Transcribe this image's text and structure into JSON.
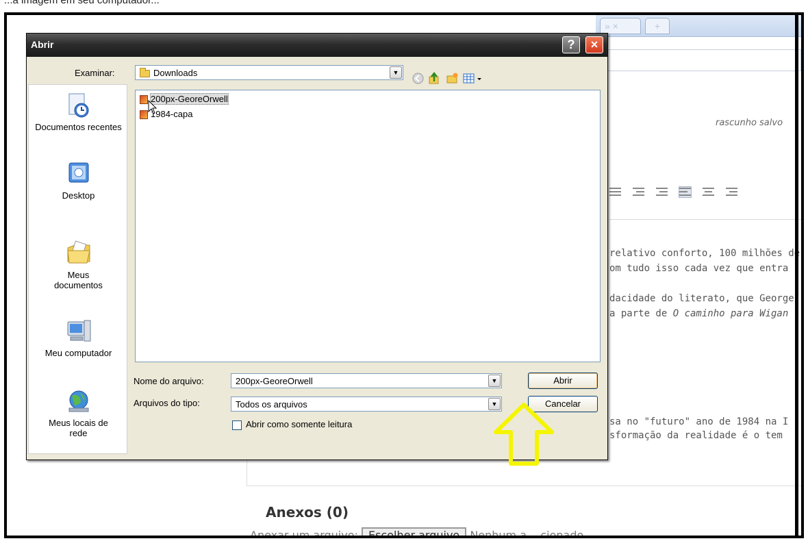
{
  "caption": "...a imagem em seu computador...",
  "background": {
    "tabs": [
      "» ×",
      "+"
    ],
    "draft_status": "rascunho salvo",
    "paragraph_lines": [
      "relativo conforto, 100 milhões de",
      "om tudo isso cada vez que entra",
      "dacidade do literato, que George",
      "a parte de ",
      "sa no \"futuro\" ano de 1984 na I",
      "sformação da realidade é o tem"
    ],
    "italic_fragment": "O caminho para Wigan",
    "attachments_title": "Anexos (0)",
    "attach_label": "Anexar um arquivo:",
    "choose_file_button": "Escolher arquivo",
    "no_file_text": "Nenhum a... cionado"
  },
  "dialog": {
    "title": "Abrir",
    "help_button": "?",
    "close_button": "×",
    "look_in_label": "Examinar:",
    "look_in_value": "Downloads",
    "places": [
      {
        "label": "Documentos recentes",
        "icon": "recent-documents-icon"
      },
      {
        "label": "Desktop",
        "icon": "desktop-icon"
      },
      {
        "label": "Meus documentos",
        "icon": "my-documents-icon"
      },
      {
        "label": "Meu computador",
        "icon": "my-computer-icon"
      },
      {
        "label": "Meus locais de rede",
        "icon": "network-places-icon"
      }
    ],
    "files": [
      {
        "name": "200px-GeoreOrwell",
        "selected": true
      },
      {
        "name": "1984-capa",
        "selected": false
      }
    ],
    "filename_label": "Nome do arquivo:",
    "filename_value": "200px-GeoreOrwell",
    "filetype_label": "Arquivos do tipo:",
    "filetype_value": "Todos os arquivos",
    "open_button": "Abrir",
    "cancel_button": "Cancelar",
    "readonly_label": "Abrir como somente leitura"
  },
  "colors": {
    "highlight_arrow": "#f5f500",
    "dialog_face": "#ece9d8",
    "title_bar": "#2d2d2d"
  }
}
